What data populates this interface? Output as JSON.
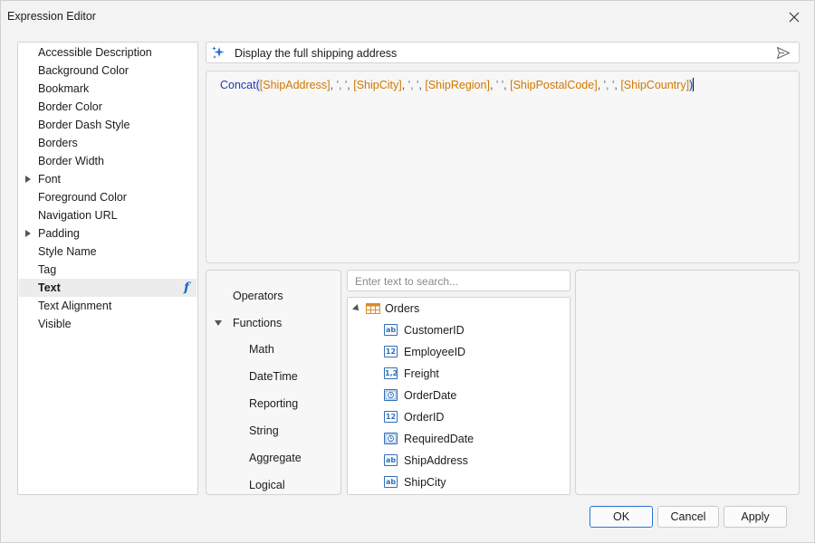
{
  "window": {
    "title": "Expression Editor"
  },
  "properties": [
    {
      "label": "Accessible Description",
      "expandable": false,
      "selected": false
    },
    {
      "label": "Background Color",
      "expandable": false,
      "selected": false
    },
    {
      "label": "Bookmark",
      "expandable": false,
      "selected": false
    },
    {
      "label": "Border Color",
      "expandable": false,
      "selected": false
    },
    {
      "label": "Border Dash Style",
      "expandable": false,
      "selected": false
    },
    {
      "label": "Borders",
      "expandable": false,
      "selected": false
    },
    {
      "label": "Border Width",
      "expandable": false,
      "selected": false
    },
    {
      "label": "Font",
      "expandable": true,
      "selected": false
    },
    {
      "label": "Foreground Color",
      "expandable": false,
      "selected": false
    },
    {
      "label": "Navigation URL",
      "expandable": false,
      "selected": false
    },
    {
      "label": "Padding",
      "expandable": true,
      "selected": false
    },
    {
      "label": "Style Name",
      "expandable": false,
      "selected": false
    },
    {
      "label": "Tag",
      "expandable": false,
      "selected": false
    },
    {
      "label": "Text",
      "expandable": false,
      "selected": true
    },
    {
      "label": "Text Alignment",
      "expandable": false,
      "selected": false
    },
    {
      "label": "Visible",
      "expandable": false,
      "selected": false
    }
  ],
  "ai_prompt": {
    "text": "Display the full shipping address"
  },
  "expression": {
    "function": "Concat",
    "tokens": [
      {
        "t": "(",
        "k": "paren"
      },
      {
        "t": "[ShipAddress]",
        "k": "fld"
      },
      {
        "t": ", ",
        "k": "pun"
      },
      {
        "t": "', '",
        "k": "str"
      },
      {
        "t": ", ",
        "k": "pun"
      },
      {
        "t": "[ShipCity]",
        "k": "fld"
      },
      {
        "t": ", ",
        "k": "pun"
      },
      {
        "t": "', '",
        "k": "str"
      },
      {
        "t": ", ",
        "k": "pun"
      },
      {
        "t": "[ShipRegion]",
        "k": "fld"
      },
      {
        "t": ", ",
        "k": "pun"
      },
      {
        "t": "' '",
        "k": "str"
      },
      {
        "t": ", ",
        "k": "pun"
      },
      {
        "t": "[ShipPostalCode]",
        "k": "fld"
      },
      {
        "t": ", ",
        "k": "pun"
      },
      {
        "t": "', '",
        "k": "str"
      },
      {
        "t": ", ",
        "k": "pun"
      },
      {
        "t": "[ShipCountry]",
        "k": "fld"
      },
      {
        "t": ")",
        "k": "paren"
      }
    ]
  },
  "categories": {
    "operators": "Operators",
    "functions": "Functions",
    "function_groups": [
      "Math",
      "DateTime",
      "Reporting",
      "String",
      "Aggregate",
      "Logical"
    ]
  },
  "search": {
    "placeholder": "Enter text to search..."
  },
  "tree": {
    "root": "Orders",
    "fields": [
      {
        "name": "CustomerID",
        "icon": "ab"
      },
      {
        "name": "EmployeeID",
        "icon": "12"
      },
      {
        "name": "Freight",
        "icon": "1,2"
      },
      {
        "name": "OrderDate",
        "icon": "clock"
      },
      {
        "name": "OrderID",
        "icon": "12"
      },
      {
        "name": "RequiredDate",
        "icon": "clock"
      },
      {
        "name": "ShipAddress",
        "icon": "ab"
      },
      {
        "name": "ShipCity",
        "icon": "ab"
      }
    ]
  },
  "buttons": {
    "ok": "OK",
    "cancel": "Cancel",
    "apply": "Apply"
  },
  "colors": {
    "field": "#d07800",
    "function": "#1f3aa8",
    "accent": "#2a6fd6"
  }
}
